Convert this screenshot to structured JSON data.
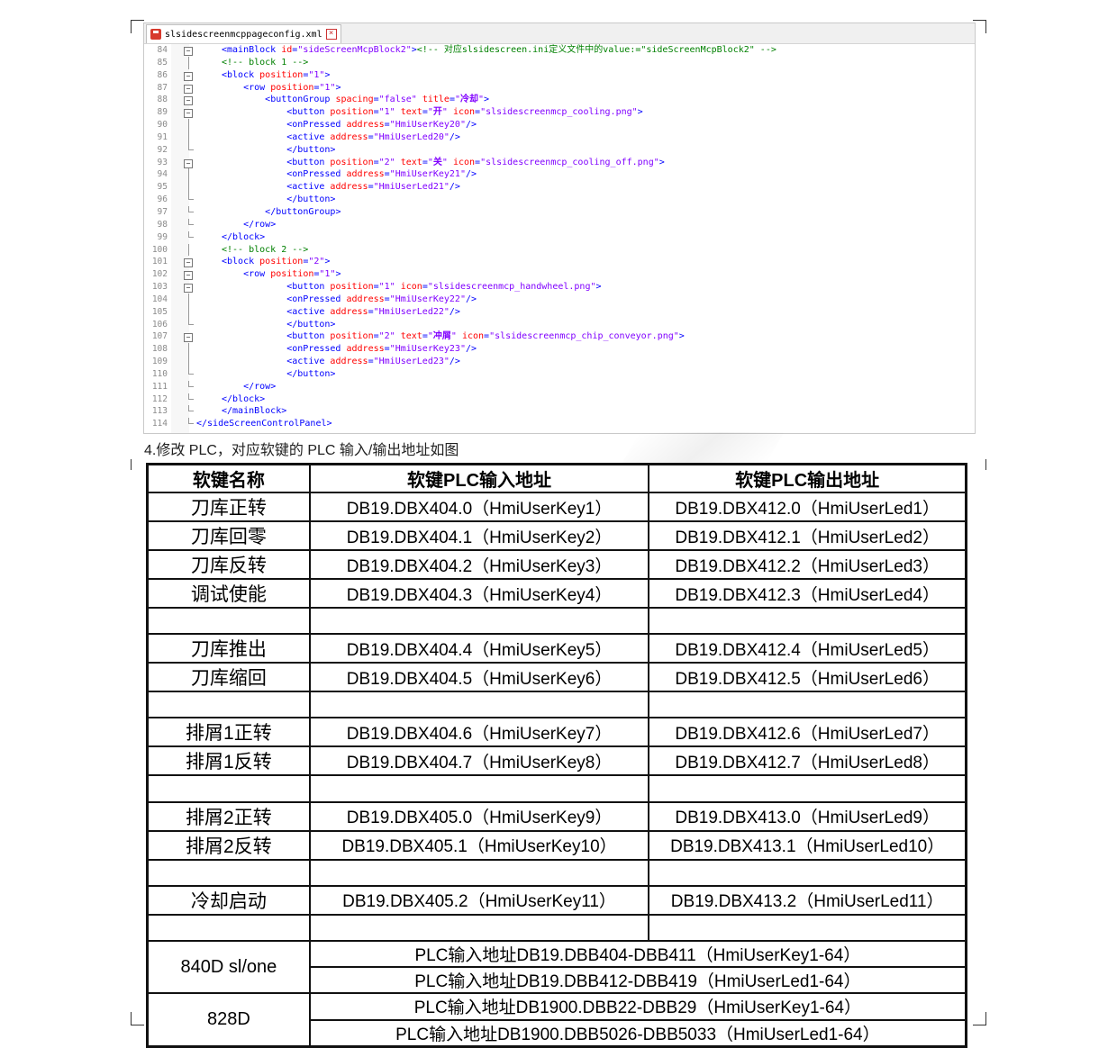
{
  "editor": {
    "tab_title": "slsidescreenmcppageconfig.xml",
    "lines": [
      {
        "num": "84",
        "indent": "",
        "parts": [
          {
            "c": "tag",
            "t": "<mainBlock "
          },
          {
            "c": "attr",
            "t": "id"
          },
          {
            "c": "tag",
            "t": "="
          },
          {
            "c": "val",
            "t": "\"sideScreenMcpBlock2\""
          },
          {
            "c": "tag",
            "t": ">"
          },
          {
            "c": "cmt",
            "t": "<!-- 对应slsidescreen.ini定义文件中的value:=\"sideScreenMcpBlock2\" -->"
          }
        ],
        "fold": "box"
      },
      {
        "num": "85",
        "indent": "",
        "parts": [
          {
            "c": "cmt",
            "t": "<!-- block 1 -->"
          }
        ],
        "fold": "line"
      },
      {
        "num": "86",
        "indent": "",
        "parts": [
          {
            "c": "tag",
            "t": "<block "
          },
          {
            "c": "attr",
            "t": "position"
          },
          {
            "c": "tag",
            "t": "="
          },
          {
            "c": "val",
            "t": "\"1\""
          },
          {
            "c": "tag",
            "t": ">"
          }
        ],
        "fold": "box"
      },
      {
        "num": "87",
        "indent": "    ",
        "parts": [
          {
            "c": "tag",
            "t": "<row "
          },
          {
            "c": "attr",
            "t": "position"
          },
          {
            "c": "tag",
            "t": "="
          },
          {
            "c": "val",
            "t": "\"1\""
          },
          {
            "c": "tag",
            "t": ">"
          }
        ],
        "fold": "box"
      },
      {
        "num": "88",
        "indent": "        ",
        "parts": [
          {
            "c": "tag",
            "t": "<buttonGroup "
          },
          {
            "c": "attr",
            "t": "spacing"
          },
          {
            "c": "tag",
            "t": "="
          },
          {
            "c": "val",
            "t": "\"false\""
          },
          {
            "c": "tag",
            "t": " "
          },
          {
            "c": "attr",
            "t": "title"
          },
          {
            "c": "tag",
            "t": "="
          },
          {
            "c": "val",
            "t": "\""
          },
          {
            "c": "cn",
            "t": "冷却"
          },
          {
            "c": "val",
            "t": "\""
          },
          {
            "c": "tag",
            "t": ">"
          }
        ],
        "fold": "box"
      },
      {
        "num": "89",
        "indent": "            ",
        "parts": [
          {
            "c": "tag",
            "t": "<button "
          },
          {
            "c": "attr",
            "t": "position"
          },
          {
            "c": "tag",
            "t": "="
          },
          {
            "c": "val",
            "t": "\"1\""
          },
          {
            "c": "tag",
            "t": " "
          },
          {
            "c": "attr",
            "t": "text"
          },
          {
            "c": "tag",
            "t": "="
          },
          {
            "c": "val",
            "t": "\""
          },
          {
            "c": "cn",
            "t": "开"
          },
          {
            "c": "val",
            "t": "\""
          },
          {
            "c": "tag",
            "t": " "
          },
          {
            "c": "attr",
            "t": "icon"
          },
          {
            "c": "tag",
            "t": "="
          },
          {
            "c": "val",
            "t": "\"slsidescreenmcp_cooling.png\""
          },
          {
            "c": "tag",
            "t": ">"
          }
        ],
        "fold": "box"
      },
      {
        "num": "90",
        "indent": "            ",
        "parts": [
          {
            "c": "tag",
            "t": "<onPressed "
          },
          {
            "c": "attr",
            "t": "address"
          },
          {
            "c": "tag",
            "t": "="
          },
          {
            "c": "val",
            "t": "\"HmiUserKey20\""
          },
          {
            "c": "tag",
            "t": "/>"
          }
        ],
        "fold": "line"
      },
      {
        "num": "91",
        "indent": "            ",
        "parts": [
          {
            "c": "tag",
            "t": "<active "
          },
          {
            "c": "attr",
            "t": "address"
          },
          {
            "c": "tag",
            "t": "="
          },
          {
            "c": "val",
            "t": "\"HmiUserLed20\""
          },
          {
            "c": "tag",
            "t": "/>"
          }
        ],
        "fold": "line"
      },
      {
        "num": "92",
        "indent": "            ",
        "parts": [
          {
            "c": "tag",
            "t": "</button>"
          }
        ],
        "fold": "end"
      },
      {
        "num": "93",
        "indent": "            ",
        "parts": [
          {
            "c": "tag",
            "t": "<button "
          },
          {
            "c": "attr",
            "t": "position"
          },
          {
            "c": "tag",
            "t": "="
          },
          {
            "c": "val",
            "t": "\"2\""
          },
          {
            "c": "tag",
            "t": " "
          },
          {
            "c": "attr",
            "t": "text"
          },
          {
            "c": "tag",
            "t": "="
          },
          {
            "c": "val",
            "t": "\""
          },
          {
            "c": "cn",
            "t": "关"
          },
          {
            "c": "val",
            "t": "\""
          },
          {
            "c": "tag",
            "t": " "
          },
          {
            "c": "attr",
            "t": "icon"
          },
          {
            "c": "tag",
            "t": "="
          },
          {
            "c": "val",
            "t": "\"slsidescreenmcp_cooling_off.png\""
          },
          {
            "c": "tag",
            "t": ">"
          }
        ],
        "fold": "box"
      },
      {
        "num": "94",
        "indent": "            ",
        "parts": [
          {
            "c": "tag",
            "t": "<onPressed "
          },
          {
            "c": "attr",
            "t": "address"
          },
          {
            "c": "tag",
            "t": "="
          },
          {
            "c": "val",
            "t": "\"HmiUserKey21\""
          },
          {
            "c": "tag",
            "t": "/>"
          }
        ],
        "fold": "line"
      },
      {
        "num": "95",
        "indent": "            ",
        "parts": [
          {
            "c": "tag",
            "t": "<active "
          },
          {
            "c": "attr",
            "t": "address"
          },
          {
            "c": "tag",
            "t": "="
          },
          {
            "c": "val",
            "t": "\"HmiUserLed21\""
          },
          {
            "c": "tag",
            "t": "/>"
          }
        ],
        "fold": "line"
      },
      {
        "num": "96",
        "indent": "            ",
        "parts": [
          {
            "c": "tag",
            "t": "</button>"
          }
        ],
        "fold": "end"
      },
      {
        "num": "97",
        "indent": "        ",
        "parts": [
          {
            "c": "tag",
            "t": "</buttonGroup>"
          }
        ],
        "fold": "end"
      },
      {
        "num": "98",
        "indent": "    ",
        "parts": [
          {
            "c": "tag",
            "t": "</row>"
          }
        ],
        "fold": "end"
      },
      {
        "num": "99",
        "indent": "",
        "parts": [
          {
            "c": "tag",
            "t": "</block>"
          }
        ],
        "fold": "end"
      },
      {
        "num": "100",
        "indent": "",
        "parts": [
          {
            "c": "cmt",
            "t": "<!-- block 2 -->"
          }
        ],
        "fold": "line"
      },
      {
        "num": "101",
        "indent": "",
        "parts": [
          {
            "c": "tag",
            "t": "<block "
          },
          {
            "c": "attr",
            "t": "position"
          },
          {
            "c": "tag",
            "t": "="
          },
          {
            "c": "val",
            "t": "\"2\""
          },
          {
            "c": "tag",
            "t": ">"
          }
        ],
        "fold": "box"
      },
      {
        "num": "102",
        "indent": "    ",
        "parts": [
          {
            "c": "tag",
            "t": "<row "
          },
          {
            "c": "attr",
            "t": "position"
          },
          {
            "c": "tag",
            "t": "="
          },
          {
            "c": "val",
            "t": "\"1\""
          },
          {
            "c": "tag",
            "t": ">"
          }
        ],
        "fold": "box"
      },
      {
        "num": "103",
        "indent": "            ",
        "parts": [
          {
            "c": "tag",
            "t": "<button "
          },
          {
            "c": "attr",
            "t": "position"
          },
          {
            "c": "tag",
            "t": "="
          },
          {
            "c": "val",
            "t": "\"1\""
          },
          {
            "c": "tag",
            "t": " "
          },
          {
            "c": "attr",
            "t": "icon"
          },
          {
            "c": "tag",
            "t": "="
          },
          {
            "c": "val",
            "t": "\"slsidescreenmcp_handwheel.png\""
          },
          {
            "c": "tag",
            "t": ">"
          }
        ],
        "fold": "box"
      },
      {
        "num": "104",
        "indent": "            ",
        "parts": [
          {
            "c": "tag",
            "t": "<onPressed "
          },
          {
            "c": "attr",
            "t": "address"
          },
          {
            "c": "tag",
            "t": "="
          },
          {
            "c": "val",
            "t": "\"HmiUserKey22\""
          },
          {
            "c": "tag",
            "t": "/>"
          }
        ],
        "fold": "line"
      },
      {
        "num": "105",
        "indent": "            ",
        "parts": [
          {
            "c": "tag",
            "t": "<active "
          },
          {
            "c": "attr",
            "t": "address"
          },
          {
            "c": "tag",
            "t": "="
          },
          {
            "c": "val",
            "t": "\"HmiUserLed22\""
          },
          {
            "c": "tag",
            "t": "/>"
          }
        ],
        "fold": "line"
      },
      {
        "num": "106",
        "indent": "            ",
        "parts": [
          {
            "c": "tag",
            "t": "</button>"
          }
        ],
        "fold": "end"
      },
      {
        "num": "107",
        "indent": "            ",
        "parts": [
          {
            "c": "tag",
            "t": "<button "
          },
          {
            "c": "attr",
            "t": "position"
          },
          {
            "c": "tag",
            "t": "="
          },
          {
            "c": "val",
            "t": "\"2\""
          },
          {
            "c": "tag",
            "t": " "
          },
          {
            "c": "attr",
            "t": "text"
          },
          {
            "c": "tag",
            "t": "="
          },
          {
            "c": "val",
            "t": "\""
          },
          {
            "c": "cn",
            "t": "冲屑"
          },
          {
            "c": "val",
            "t": "\""
          },
          {
            "c": "tag",
            "t": " "
          },
          {
            "c": "attr",
            "t": "icon"
          },
          {
            "c": "tag",
            "t": "="
          },
          {
            "c": "val",
            "t": "\"slsidescreenmcp_chip_conveyor.png\""
          },
          {
            "c": "tag",
            "t": ">"
          }
        ],
        "fold": "box"
      },
      {
        "num": "108",
        "indent": "            ",
        "parts": [
          {
            "c": "tag",
            "t": "<onPressed "
          },
          {
            "c": "attr",
            "t": "address"
          },
          {
            "c": "tag",
            "t": "="
          },
          {
            "c": "val",
            "t": "\"HmiUserKey23\""
          },
          {
            "c": "tag",
            "t": "/>"
          }
        ],
        "fold": "line"
      },
      {
        "num": "109",
        "indent": "            ",
        "parts": [
          {
            "c": "tag",
            "t": "<active "
          },
          {
            "c": "attr",
            "t": "address"
          },
          {
            "c": "tag",
            "t": "="
          },
          {
            "c": "val",
            "t": "\"HmiUserLed23\""
          },
          {
            "c": "tag",
            "t": "/>"
          }
        ],
        "fold": "line"
      },
      {
        "num": "110",
        "indent": "            ",
        "parts": [
          {
            "c": "tag",
            "t": "</button>"
          }
        ],
        "fold": "end"
      },
      {
        "num": "111",
        "indent": "    ",
        "parts": [
          {
            "c": "tag",
            "t": "</row>"
          }
        ],
        "fold": "end"
      },
      {
        "num": "112",
        "indent": "",
        "parts": [
          {
            "c": "tag",
            "t": "</block>"
          }
        ],
        "fold": "end"
      },
      {
        "num": "113",
        "indent": "",
        "parts": [
          {
            "c": "tag",
            "t": "</mainBlock>"
          }
        ],
        "fold": "end"
      },
      {
        "num": "114",
        "indent": "",
        "parts": [
          {
            "c": "tag",
            "t": "</sideScreenControlPanel>"
          }
        ],
        "fold": "end-root"
      }
    ]
  },
  "section_label": "4.修改 PLC，对应软键的 PLC 输入/输出地址如图",
  "table": {
    "headers": [
      "软键名称",
      "软键PLC输入地址",
      "软键PLC输出地址"
    ],
    "rows": [
      [
        "刀库正转",
        "DB19.DBX404.0（HmiUserKey1）",
        "DB19.DBX412.0（HmiUserLed1）"
      ],
      [
        "刀库回零",
        "DB19.DBX404.1（HmiUserKey2）",
        "DB19.DBX412.1（HmiUserLed2）"
      ],
      [
        "刀库反转",
        "DB19.DBX404.2（HmiUserKey3）",
        "DB19.DBX412.2（HmiUserLed3）"
      ],
      [
        "调试使能",
        "DB19.DBX404.3（HmiUserKey4）",
        "DB19.DBX412.3（HmiUserLed4）"
      ],
      [
        "",
        "",
        ""
      ],
      [
        "刀库推出",
        "DB19.DBX404.4（HmiUserKey5）",
        "DB19.DBX412.4（HmiUserLed5）"
      ],
      [
        "刀库缩回",
        "DB19.DBX404.5（HmiUserKey6）",
        "DB19.DBX412.5（HmiUserLed6）"
      ],
      [
        "",
        "",
        ""
      ],
      [
        "排屑1正转",
        "DB19.DBX404.6（HmiUserKey7）",
        "DB19.DBX412.6（HmiUserLed7）"
      ],
      [
        "排屑1反转",
        "DB19.DBX404.7（HmiUserKey8）",
        "DB19.DBX412.7（HmiUserLed8）"
      ],
      [
        "",
        "",
        ""
      ],
      [
        "排屑2正转",
        "DB19.DBX405.0（HmiUserKey9）",
        "DB19.DBX413.0（HmiUserLed9）"
      ],
      [
        "排屑2反转",
        "DB19.DBX405.1（HmiUserKey10）",
        "DB19.DBX413.1（HmiUserLed10）"
      ],
      [
        "",
        "",
        ""
      ],
      [
        "冷却启动",
        "DB19.DBX405.2（HmiUserKey11）",
        "DB19.DBX413.2（HmiUserLed11）"
      ],
      [
        "",
        "",
        ""
      ]
    ],
    "models": [
      {
        "name": "840D sl/one",
        "lines": [
          "PLC输入地址DB19.DBB404-DBB411（HmiUserKey1-64）",
          "PLC输入地址DB19.DBB412-DBB419（HmiUserLed1-64）"
        ]
      },
      {
        "name": "828D",
        "lines": [
          "PLC输入地址DB1900.DBB22-DBB29（HmiUserKey1-64）",
          "PLC输入地址DB1900.DBB5026-DBB5033（HmiUserLed1-64）"
        ]
      }
    ]
  }
}
